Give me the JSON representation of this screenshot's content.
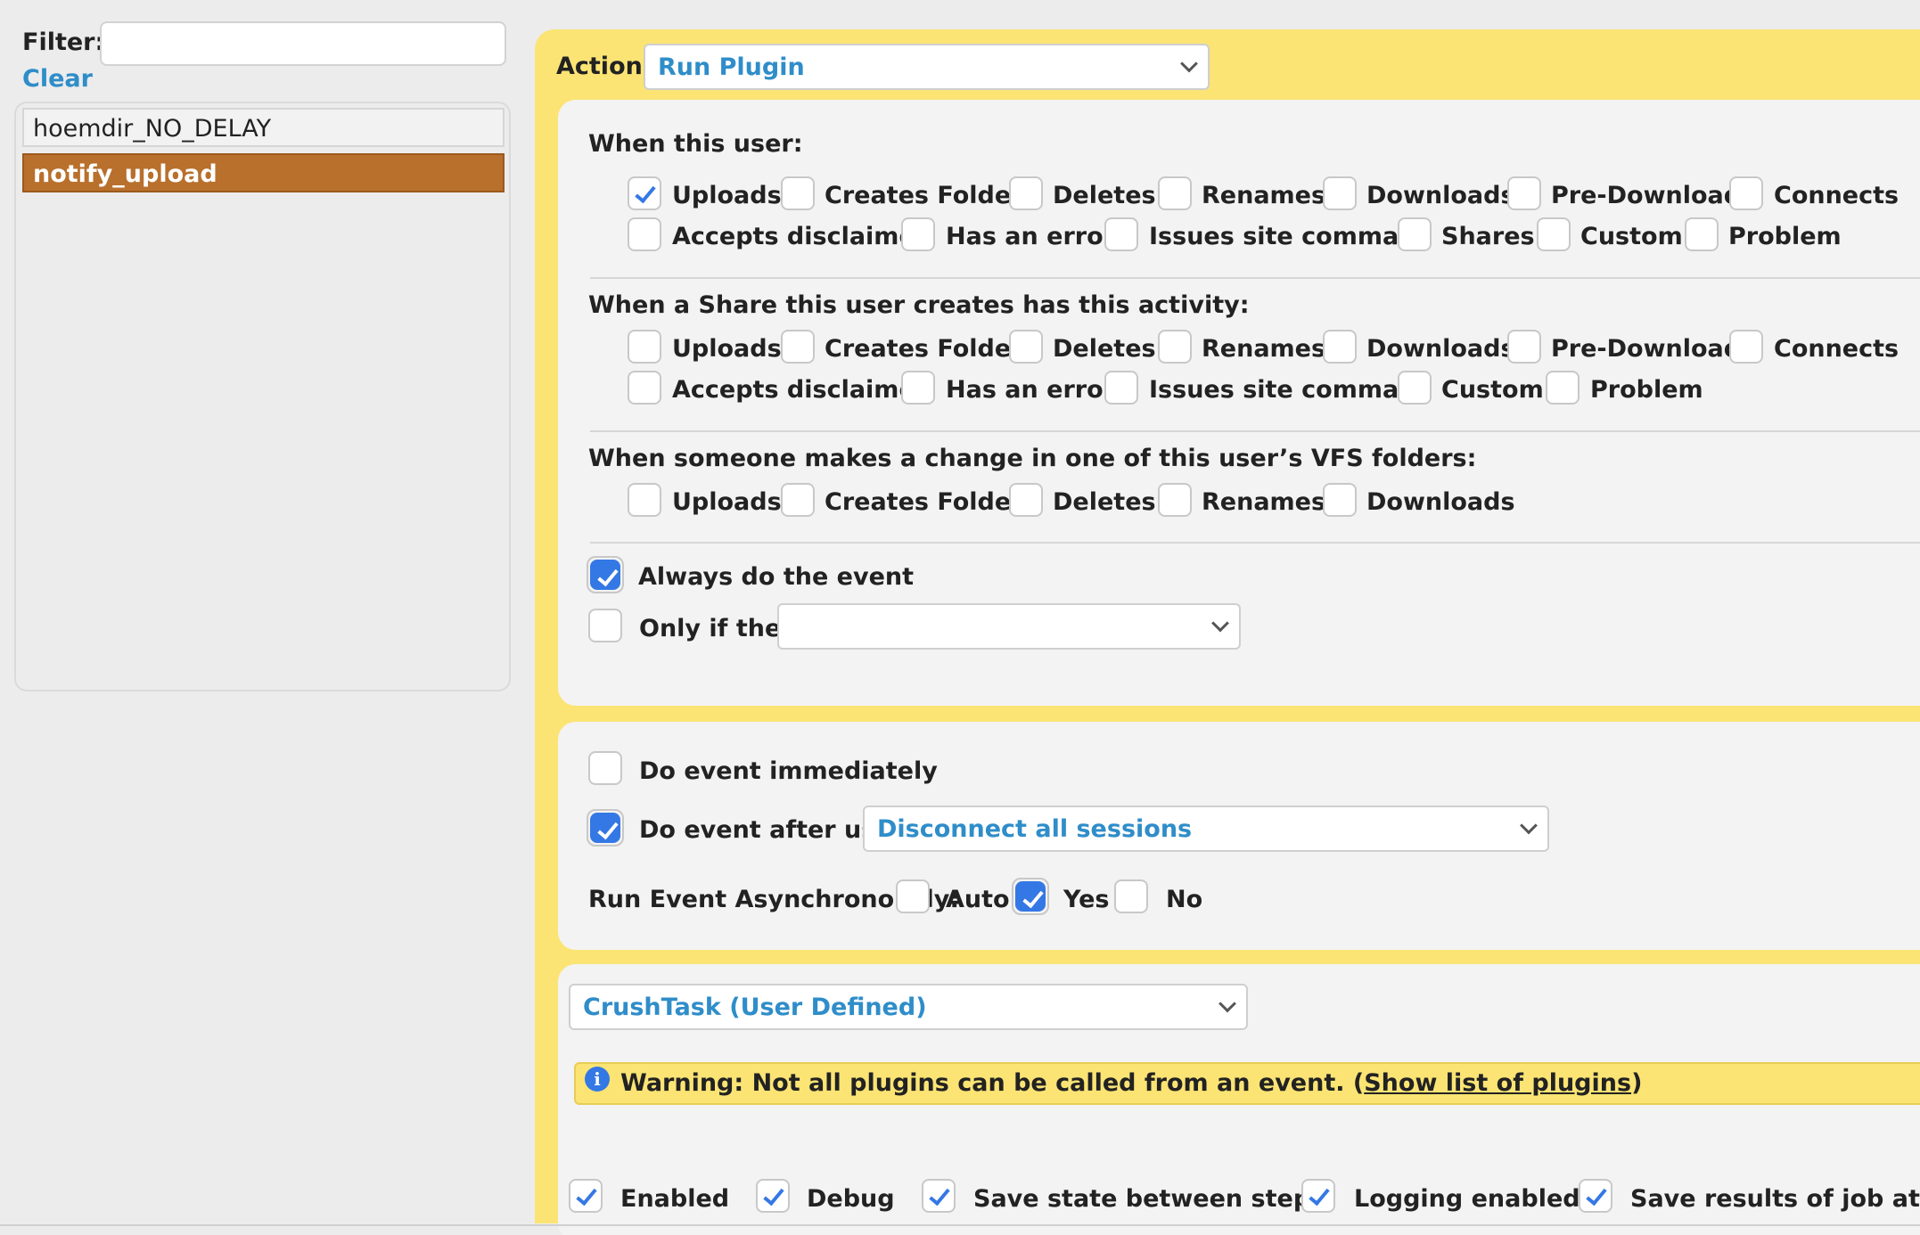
{
  "sidebar": {
    "filter_label": "Filter:",
    "filter_value": "",
    "clear_label": "Clear",
    "items": [
      {
        "label": "hoemdir_NO_DELAY",
        "selected": false
      },
      {
        "label": "notify_upload",
        "selected": true
      }
    ]
  },
  "action": {
    "label": "Action:",
    "value": "Run Plugin"
  },
  "when_user": {
    "heading": "When this user:",
    "row1": [
      {
        "label": "Uploads",
        "checked": true
      },
      {
        "label": "Creates Folder",
        "checked": false
      },
      {
        "label": "Deletes",
        "checked": false
      },
      {
        "label": "Renames",
        "checked": false
      },
      {
        "label": "Downloads",
        "checked": false
      },
      {
        "label": "Pre-Download",
        "checked": false
      },
      {
        "label": "Connects",
        "checked": false
      }
    ],
    "row2": [
      {
        "label": "Accepts disclaimer",
        "checked": false
      },
      {
        "label": "Has an error",
        "checked": false
      },
      {
        "label": "Issues site command",
        "checked": false
      },
      {
        "label": "Shares",
        "checked": false
      },
      {
        "label": "Custom",
        "checked": false
      },
      {
        "label": "Problem",
        "checked": false
      }
    ]
  },
  "when_share": {
    "heading": "When a Share this user creates has this activity:",
    "row1": [
      {
        "label": "Uploads",
        "checked": false
      },
      {
        "label": "Creates Folder",
        "checked": false
      },
      {
        "label": "Deletes",
        "checked": false
      },
      {
        "label": "Renames",
        "checked": false
      },
      {
        "label": "Downloads",
        "checked": false
      },
      {
        "label": "Pre-Download",
        "checked": false
      },
      {
        "label": "Connects",
        "checked": false
      }
    ],
    "row2": [
      {
        "label": "Accepts disclaimer",
        "checked": false
      },
      {
        "label": "Has an error",
        "checked": false
      },
      {
        "label": "Issues site command",
        "checked": false
      },
      {
        "label": "Custom",
        "checked": false
      },
      {
        "label": "Problem",
        "checked": false
      }
    ]
  },
  "when_vfs": {
    "heading": "When someone makes a change in one of this user’s VFS folders:",
    "row1": [
      {
        "label": "Uploads",
        "checked": false
      },
      {
        "label": "Creates Folder",
        "checked": false
      },
      {
        "label": "Deletes",
        "checked": false
      },
      {
        "label": "Renames",
        "checked": false
      },
      {
        "label": "Downloads",
        "checked": false
      }
    ]
  },
  "conditions": {
    "always_label": "Always do the event",
    "always_checked": true,
    "only_if_label": "Only if they",
    "only_if_checked": false,
    "only_if_value": ""
  },
  "timing": {
    "immediately_label": "Do event immediately",
    "immediately_checked": false,
    "after_label": "Do event after user",
    "after_checked": true,
    "after_value": "Disconnect all sessions",
    "async_label": "Run Event Asynchronously:",
    "async_options": [
      {
        "label": "Auto",
        "checked": false
      },
      {
        "label": "Yes",
        "checked": true
      },
      {
        "label": "No",
        "checked": false
      }
    ]
  },
  "plugin": {
    "value": "CrushTask (User Defined)",
    "warning_prefix": "Warning: Not all plugins can be called from an event. (",
    "warning_link": "Show list of plugins",
    "warning_suffix": ")",
    "options": [
      {
        "label": "Enabled",
        "checked": true
      },
      {
        "label": "Debug",
        "checked": true
      },
      {
        "label": "Save state between steps",
        "checked": true
      },
      {
        "label": "Logging enabled",
        "checked": true
      },
      {
        "label": "Save results of job at end",
        "checked": true
      }
    ]
  }
}
